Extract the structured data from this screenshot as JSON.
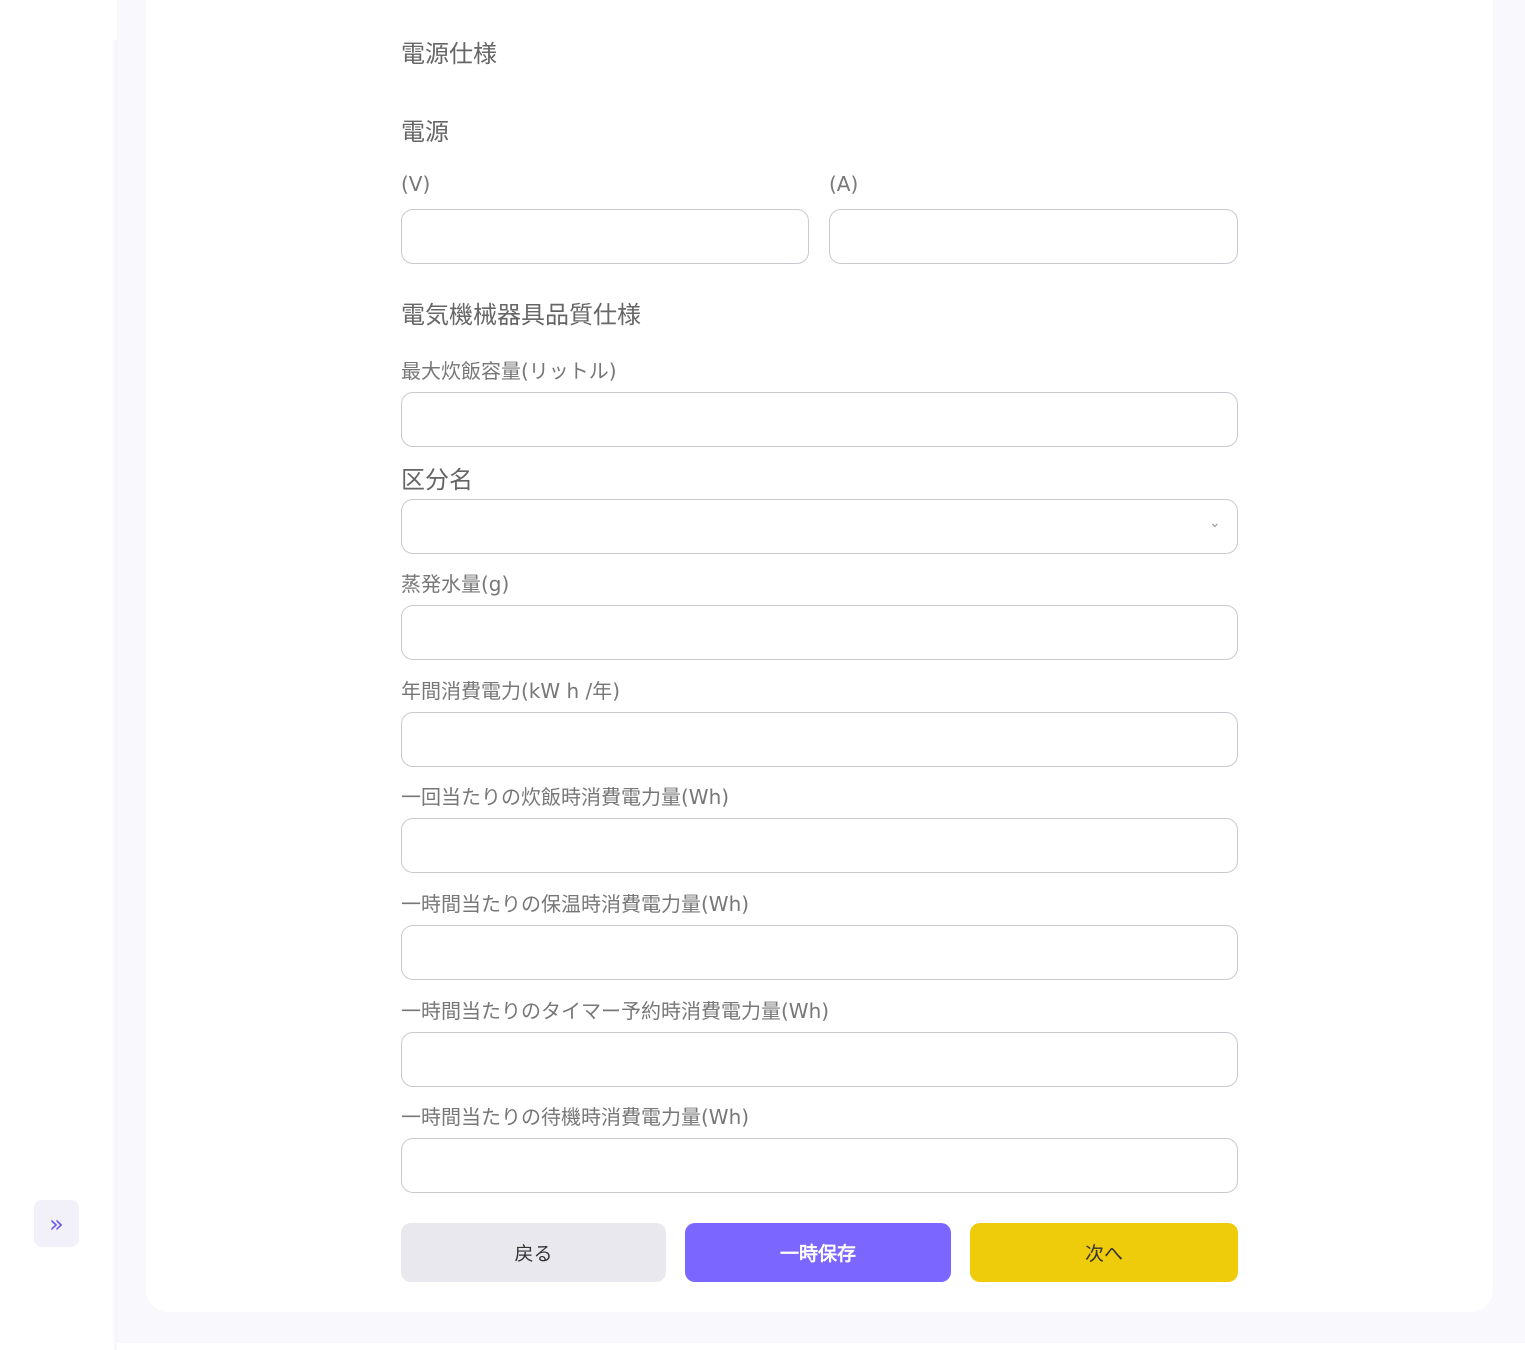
{
  "sidebar": {
    "expand_icon": "double-chevron-right-icon",
    "expand_glyph": "»"
  },
  "form": {
    "power_spec_title": "電源仕様",
    "power_title": "電源",
    "voltage_label": "(V)",
    "voltage_value": "",
    "ampere_label": "(A)",
    "ampere_value": "",
    "quality_spec_title": "電気機械器具品質仕様",
    "max_capacity_label": "最大炊飯容量(リットル)",
    "max_capacity_value": "",
    "category_label": "区分名",
    "category_value": "",
    "evaporation_label": "蒸発水量(g)",
    "evaporation_value": "",
    "annual_power_label": "年間消費電力(kW h /年)",
    "annual_power_value": "",
    "per_cook_label": "一回当たりの炊飯時消費電力量(Wh)",
    "per_cook_value": "",
    "keep_warm_label": "一時間当たりの保温時消費電力量(Wh)",
    "keep_warm_value": "",
    "timer_label": "一時間当たりのタイマー予約時消費電力量(Wh)",
    "timer_value": "",
    "standby_label": "一時間当たりの待機時消費電力量(Wh)",
    "standby_value": ""
  },
  "buttons": {
    "back": "戻る",
    "save_draft": "一時保存",
    "next": "次へ"
  },
  "colors": {
    "accent": "#7b66ff",
    "next": "#eecb0b",
    "back": "#e8e8ee"
  }
}
